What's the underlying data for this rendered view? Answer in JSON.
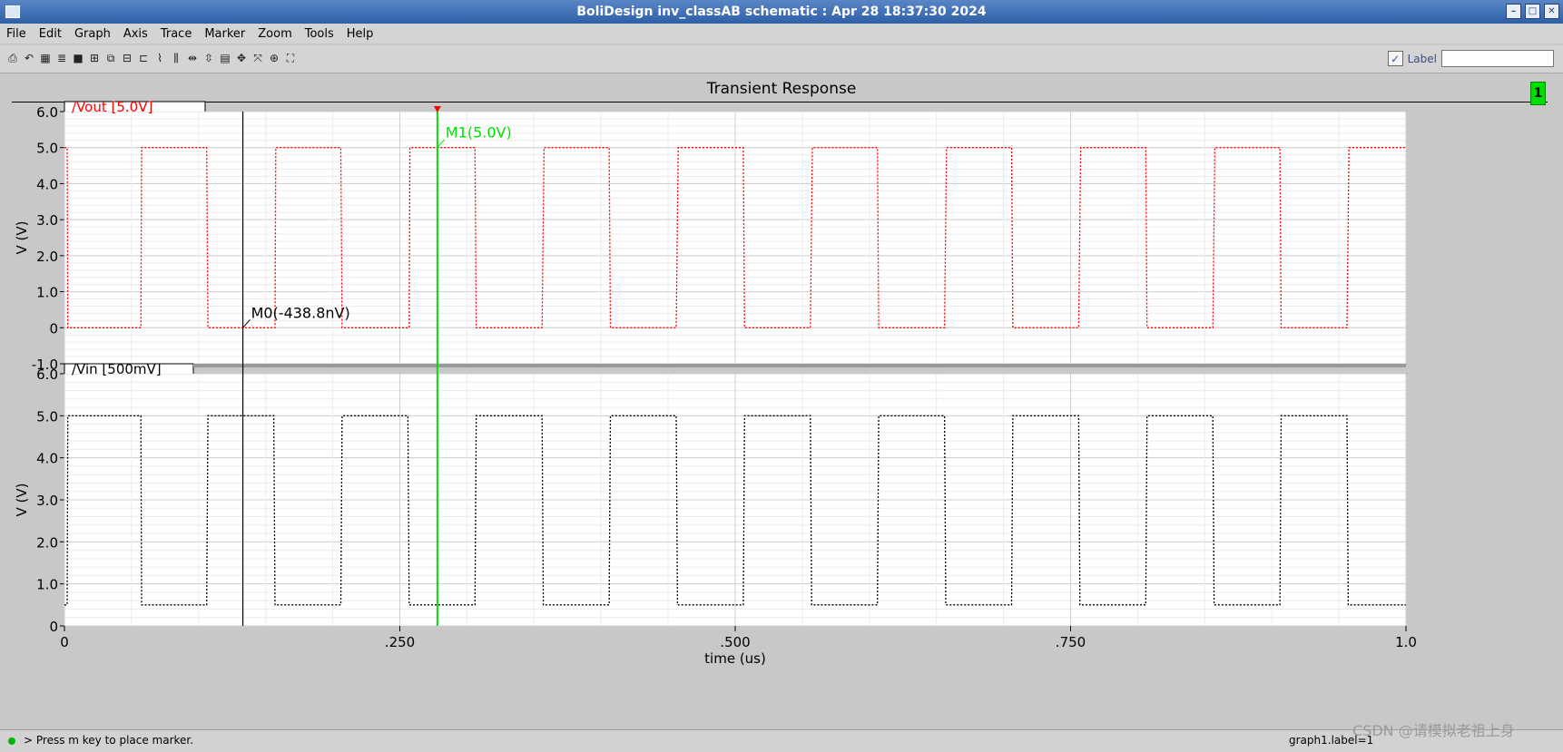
{
  "window": {
    "title": "BoliDesign inv_classAB schematic : Apr 28 18:37:30 2024"
  },
  "menu": {
    "items": [
      "File",
      "Edit",
      "Graph",
      "Axis",
      "Trace",
      "Marker",
      "Zoom",
      "Tools",
      "Help"
    ]
  },
  "toolbar": {
    "icons": [
      "print-icon",
      "undo-icon",
      "grid-icon",
      "strip-icon",
      "box-icon",
      "fit-icon",
      "copy-icon",
      "overlay-icon",
      "split-icon",
      "trace-icon",
      "bars-icon",
      "cursor-h-icon",
      "cursor-v-icon",
      "calc-icon",
      "move-icon",
      "zoom-fit-icon",
      "zoom-box-icon",
      "zoom-all-icon"
    ],
    "label_caption": "Label",
    "label_value": ""
  },
  "graph": {
    "title": "Transient Response",
    "graph_id": "1"
  },
  "chart_data": [
    {
      "type": "line",
      "series": [
        {
          "name": "/Vout  [5.0V]",
          "color": "#ff0000",
          "style": "dotted",
          "x": [
            0.0,
            0.002,
            0.0025,
            0.057,
            0.0575,
            0.106,
            0.107,
            0.157,
            0.1575,
            0.206,
            0.207,
            0.257,
            0.2575,
            0.306,
            0.307,
            0.356,
            0.3575,
            0.406,
            0.407,
            0.456,
            0.4575,
            0.506,
            0.507,
            0.556,
            0.5575,
            0.606,
            0.607,
            0.656,
            0.6575,
            0.706,
            0.707,
            0.756,
            0.7575,
            0.806,
            0.807,
            0.856,
            0.8575,
            0.906,
            0.907,
            0.956,
            0.9575,
            1.0
          ],
          "y": [
            5,
            5,
            0,
            0,
            5,
            5,
            0,
            0,
            5,
            5,
            0,
            0,
            5,
            5,
            0,
            0,
            5,
            5,
            0,
            0,
            5,
            5,
            0,
            0,
            5,
            5,
            0,
            0,
            5,
            5,
            0,
            0,
            5,
            5,
            0,
            0,
            5,
            5,
            0,
            0,
            5,
            5
          ]
        }
      ],
      "ylabel": "V (V)",
      "xlim": [
        0,
        1.0
      ],
      "ylim": [
        -1.0,
        6.0
      ],
      "yticks": [
        "6.0",
        "5.0",
        "4.0",
        "3.0",
        "2.0",
        "1.0",
        "0",
        "-1.0"
      ],
      "grid": true,
      "markers": [
        {
          "name": "M1",
          "label": "M1(5.0V)",
          "x": 0.278,
          "color": "#00e000"
        },
        {
          "name": "M0",
          "label": "M0(-438.8nV)",
          "x": 0.133,
          "color": "#000000"
        }
      ]
    },
    {
      "type": "line",
      "series": [
        {
          "name": "/Vin  [500mV]",
          "color": "#000000",
          "style": "dotted",
          "x": [
            0.0,
            0.002,
            0.0025,
            0.057,
            0.0575,
            0.106,
            0.107,
            0.156,
            0.157,
            0.206,
            0.207,
            0.256,
            0.257,
            0.306,
            0.307,
            0.356,
            0.357,
            0.406,
            0.407,
            0.456,
            0.457,
            0.506,
            0.507,
            0.556,
            0.557,
            0.606,
            0.607,
            0.656,
            0.657,
            0.706,
            0.707,
            0.756,
            0.757,
            0.806,
            0.807,
            0.856,
            0.857,
            0.906,
            0.907,
            0.956,
            0.957,
            1.0
          ],
          "y": [
            0.5,
            0.5,
            5,
            5,
            0.5,
            0.5,
            5,
            5,
            0.5,
            0.5,
            5,
            5,
            0.5,
            0.5,
            5,
            5,
            0.5,
            0.5,
            5,
            5,
            0.5,
            0.5,
            5,
            5,
            0.5,
            0.5,
            5,
            5,
            0.5,
            0.5,
            5,
            5,
            0.5,
            0.5,
            5,
            5,
            0.5,
            0.5,
            5,
            5,
            0.5,
            0.5
          ]
        }
      ],
      "xlabel": "time (us)",
      "ylabel": "V (V)",
      "xlim": [
        0,
        1.0
      ],
      "ylim": [
        0,
        6.0
      ],
      "yticks": [
        "6.0",
        "5.0",
        "4.0",
        "3.0",
        "2.0",
        "1.0",
        "0"
      ],
      "xticks": [
        {
          "value": 0,
          "label": "0"
        },
        {
          "value": 0.25,
          "label": ".250"
        },
        {
          "value": 0.5,
          "label": ".500"
        },
        {
          "value": 0.75,
          "label": ".750"
        },
        {
          "value": 1.0,
          "label": "1.0"
        }
      ],
      "grid": true
    }
  ],
  "status": {
    "message": "> Press m key to place marker.",
    "right_text": "graph1.label=1"
  },
  "watermark": "CSDN @请模拟老祖上身"
}
